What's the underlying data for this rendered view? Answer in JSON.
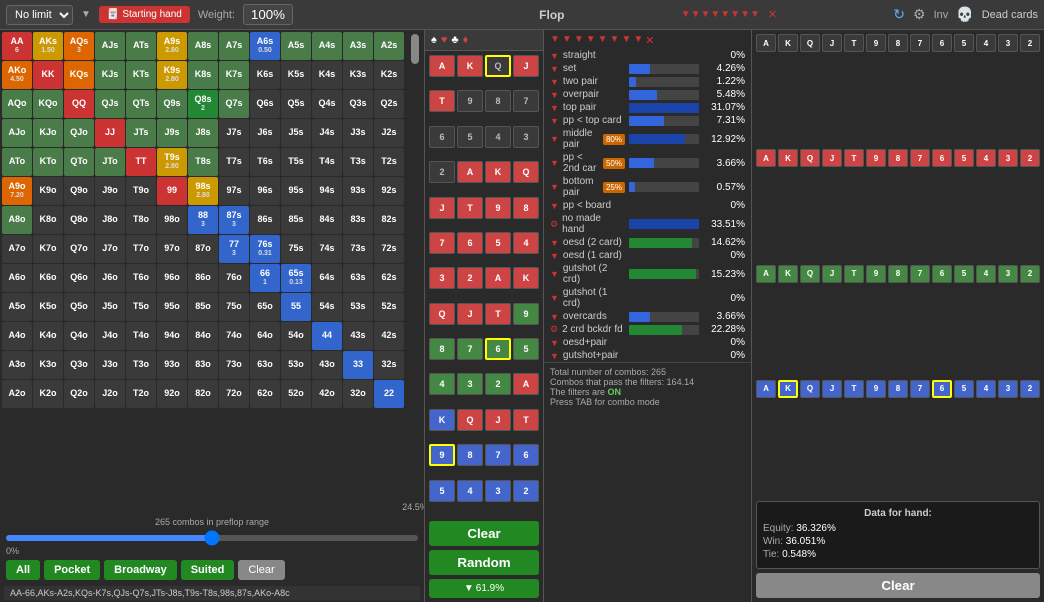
{
  "topbar": {
    "limit_label": "No limit",
    "starting_hand_label": "Starting hand",
    "weight_label": "Weight:",
    "weight_value": "100%",
    "flop_label": "Flop",
    "inv_label": "Inv",
    "dead_cards_label": "Dead cards"
  },
  "range_grid": {
    "combos_info": "265 combos in preflop range",
    "pct_label": "24.5%",
    "pct_zero": "0%",
    "range_text": "AA-66,AKs-A2s,KQs-K7s,QJs-Q7s,JTs-J8s,T9s-T8s,98s,87s,AKo-A8c"
  },
  "bottom_buttons": {
    "all": "All",
    "pocket": "Pocket",
    "broadway": "Broadway",
    "suited": "Suited",
    "clear": "Clear"
  },
  "flop": {
    "clear_label": "Clear",
    "random_label": "Random",
    "filter_pct": "61.9%"
  },
  "stats": {
    "rows": [
      {
        "label": "straight",
        "pct": "0%",
        "bar": 0,
        "badge": ""
      },
      {
        "label": "set",
        "pct": "4.26%",
        "bar": 30,
        "badge": ""
      },
      {
        "label": "two pair",
        "pct": "1.22%",
        "bar": 10,
        "badge": ""
      },
      {
        "label": "overpair",
        "pct": "5.48%",
        "bar": 40,
        "badge": ""
      },
      {
        "label": "top pair",
        "pct": "31.07%",
        "bar": 100,
        "badge": ""
      },
      {
        "label": "pp < top card",
        "pct": "7.31%",
        "bar": 50,
        "badge": ""
      },
      {
        "label": "middle pair",
        "pct": "12.92%",
        "bar": 80,
        "badge": "80%"
      },
      {
        "label": "pp < 2nd car",
        "pct": "3.66%",
        "bar": 35,
        "badge": "50%"
      },
      {
        "label": "bottom pair",
        "pct": "0.57%",
        "bar": 8,
        "badge": "25%"
      },
      {
        "label": "pp < board",
        "pct": "0%",
        "bar": 0,
        "badge": ""
      },
      {
        "label": "no made hand",
        "pct": "33.51%",
        "bar": 100,
        "badge": ""
      },
      {
        "label": "oesd (2 card)",
        "pct": "14.62%",
        "bar": 90,
        "badge": ""
      },
      {
        "label": "oesd (1 card)",
        "pct": "0%",
        "bar": 0,
        "badge": ""
      },
      {
        "label": "gutshot (2 crd)",
        "pct": "15.23%",
        "bar": 95,
        "badge": ""
      },
      {
        "label": "gutshot (1 crd)",
        "pct": "0%",
        "bar": 0,
        "badge": ""
      },
      {
        "label": "overcards",
        "pct": "3.66%",
        "bar": 30,
        "badge": ""
      },
      {
        "label": "2 crd bckdr fd",
        "pct": "22.28%",
        "bar": 75,
        "badge": ""
      },
      {
        "label": "oesd+pair",
        "pct": "0%",
        "bar": 0,
        "badge": ""
      },
      {
        "label": "gutshot+pair",
        "pct": "0%",
        "bar": 0,
        "badge": ""
      }
    ],
    "total_combos": "Total number of combos: 265",
    "combos_pass": "Combos that pass the filters: 164.14",
    "filters_on": "The filters are ON",
    "tab_hint": "Press TAB for combo mode"
  },
  "hand_data": {
    "title": "Data for hand:",
    "equity_label": "Equity:",
    "equity_val": "36.326%",
    "win_label": "Win:",
    "win_val": "36.051%",
    "tie_label": "Tie:",
    "tie_val": "0.548%"
  },
  "dead_cards": {
    "clear_label": "Clear"
  },
  "cells": [
    {
      "id": "AA",
      "label": "AA",
      "sub": "6",
      "class": "selected-red"
    },
    {
      "id": "AKs",
      "label": "AKs",
      "sub": "1.50",
      "class": "selected-yellow"
    },
    {
      "id": "AQs",
      "label": "AQs",
      "sub": "3",
      "class": "selected-orange"
    },
    {
      "id": "AJs",
      "label": "AJs",
      "sub": "",
      "class": "pocket"
    },
    {
      "id": "ATs",
      "label": "ATs",
      "sub": "",
      "class": "pocket"
    },
    {
      "id": "A9s",
      "label": "A9s",
      "sub": "2.80",
      "class": "selected-yellow"
    },
    {
      "id": "A8s",
      "label": "A8s",
      "sub": "",
      "class": "pocket"
    },
    {
      "id": "A7s",
      "label": "A7s",
      "sub": "",
      "class": "pocket"
    },
    {
      "id": "A6s",
      "label": "A6s",
      "sub": "0.50",
      "class": "selected-blue"
    },
    {
      "id": "A5s",
      "label": "A5s",
      "sub": "",
      "class": "pocket"
    },
    {
      "id": "A4s",
      "label": "A4s",
      "sub": "",
      "class": "pocket"
    },
    {
      "id": "A3s",
      "label": "A3s",
      "sub": "",
      "class": "pocket"
    },
    {
      "id": "A2s",
      "label": "A2s",
      "sub": "",
      "class": "pocket"
    },
    {
      "id": "AKo",
      "label": "AKo",
      "sub": "4.50",
      "class": "selected-orange"
    },
    {
      "id": "KK",
      "label": "KK",
      "sub": "",
      "class": "selected-red"
    },
    {
      "id": "KQs",
      "label": "KQs",
      "sub": "",
      "class": "selected-orange"
    },
    {
      "id": "KJs",
      "label": "KJs",
      "sub": "",
      "class": "pocket"
    },
    {
      "id": "KTs",
      "label": "KTs",
      "sub": "",
      "class": "pocket"
    },
    {
      "id": "K9s",
      "label": "K9s",
      "sub": "2.80",
      "class": "selected-yellow"
    },
    {
      "id": "K8s",
      "label": "K8s",
      "sub": "",
      "class": "pocket"
    },
    {
      "id": "K7s",
      "label": "K7s",
      "sub": "",
      "class": "pocket"
    },
    {
      "id": "K6s",
      "label": "K6s",
      "sub": "",
      "class": "empty"
    },
    {
      "id": "K5s",
      "label": "K5s",
      "sub": "",
      "class": "empty"
    },
    {
      "id": "K4s",
      "label": "K4s",
      "sub": "",
      "class": "empty"
    },
    {
      "id": "K3s",
      "label": "K3s",
      "sub": "",
      "class": "empty"
    },
    {
      "id": "K2s",
      "label": "K2s",
      "sub": "",
      "class": "empty"
    },
    {
      "id": "AQo",
      "label": "AQo",
      "sub": "",
      "class": "pocket"
    },
    {
      "id": "KQo",
      "label": "KQo",
      "sub": "",
      "class": "pocket"
    },
    {
      "id": "QQ",
      "label": "QQ",
      "sub": "",
      "class": "selected-red"
    },
    {
      "id": "QJs",
      "label": "QJs",
      "sub": "",
      "class": "pocket"
    },
    {
      "id": "QTs",
      "label": "QTs",
      "sub": "",
      "class": "pocket"
    },
    {
      "id": "Q9s",
      "label": "Q9s",
      "sub": "",
      "class": "pocket"
    },
    {
      "id": "Q8s",
      "label": "Q8s",
      "sub": "2",
      "class": "selected-green"
    },
    {
      "id": "Q7s",
      "label": "Q7s",
      "sub": "",
      "class": "pocket"
    },
    {
      "id": "Q6s",
      "label": "Q6s",
      "sub": "",
      "class": "empty"
    },
    {
      "id": "Q5s",
      "label": "Q5s",
      "sub": "",
      "class": "empty"
    },
    {
      "id": "Q4s",
      "label": "Q4s",
      "sub": "",
      "class": "empty"
    },
    {
      "id": "Q3s",
      "label": "Q3s",
      "sub": "",
      "class": "empty"
    },
    {
      "id": "Q2s",
      "label": "Q2s",
      "sub": "",
      "class": "empty"
    },
    {
      "id": "AJo",
      "label": "AJo",
      "sub": "",
      "class": "pocket"
    },
    {
      "id": "KJo",
      "label": "KJo",
      "sub": "",
      "class": "pocket"
    },
    {
      "id": "QJo",
      "label": "QJo",
      "sub": "",
      "class": "pocket"
    },
    {
      "id": "JJ",
      "label": "JJ",
      "sub": "",
      "class": "selected-red"
    },
    {
      "id": "JTs",
      "label": "JTs",
      "sub": "",
      "class": "pocket"
    },
    {
      "id": "J9s",
      "label": "J9s",
      "sub": "",
      "class": "pocket"
    },
    {
      "id": "J8s",
      "label": "J8s",
      "sub": "",
      "class": "pocket"
    },
    {
      "id": "J7s",
      "label": "J7s",
      "sub": "",
      "class": "empty"
    },
    {
      "id": "J6s",
      "label": "J6s",
      "sub": "",
      "class": "empty"
    },
    {
      "id": "J5s",
      "label": "J5s",
      "sub": "",
      "class": "empty"
    },
    {
      "id": "J4s",
      "label": "J4s",
      "sub": "",
      "class": "empty"
    },
    {
      "id": "J3s",
      "label": "J3s",
      "sub": "",
      "class": "empty"
    },
    {
      "id": "J2s",
      "label": "J2s",
      "sub": "",
      "class": "empty"
    },
    {
      "id": "ATo",
      "label": "ATo",
      "sub": "",
      "class": "pocket"
    },
    {
      "id": "KTo",
      "label": "KTo",
      "sub": "",
      "class": "pocket"
    },
    {
      "id": "QTo",
      "label": "QTo",
      "sub": "",
      "class": "pocket"
    },
    {
      "id": "JTo",
      "label": "JTo",
      "sub": "",
      "class": "pocket"
    },
    {
      "id": "TT",
      "label": "TT",
      "sub": "",
      "class": "selected-red"
    },
    {
      "id": "T9s",
      "label": "T9s",
      "sub": "2.80",
      "class": "selected-yellow"
    },
    {
      "id": "T8s",
      "label": "T8s",
      "sub": "",
      "class": "pocket"
    },
    {
      "id": "T7s",
      "label": "T7s",
      "sub": "",
      "class": "empty"
    },
    {
      "id": "T6s",
      "label": "T6s",
      "sub": "",
      "class": "empty"
    },
    {
      "id": "T5s",
      "label": "T5s",
      "sub": "",
      "class": "empty"
    },
    {
      "id": "T4s",
      "label": "T4s",
      "sub": "",
      "class": "empty"
    },
    {
      "id": "T3s",
      "label": "T3s",
      "sub": "",
      "class": "empty"
    },
    {
      "id": "T2s",
      "label": "T2s",
      "sub": "",
      "class": "empty"
    },
    {
      "id": "A9o",
      "label": "A9o",
      "sub": "7.20",
      "class": "selected-orange"
    },
    {
      "id": "K9o",
      "label": "K9o",
      "sub": "",
      "class": "empty"
    },
    {
      "id": "Q9o",
      "label": "Q9o",
      "sub": "",
      "class": "empty"
    },
    {
      "id": "J9o",
      "label": "J9o",
      "sub": "",
      "class": "empty"
    },
    {
      "id": "T9o",
      "label": "T9o",
      "sub": "",
      "class": "empty"
    },
    {
      "id": "99",
      "label": "99",
      "sub": "",
      "class": "selected-red"
    },
    {
      "id": "98s",
      "label": "98s",
      "sub": "2.80",
      "class": "selected-yellow"
    },
    {
      "id": "97s",
      "label": "97s",
      "sub": "",
      "class": "empty"
    },
    {
      "id": "96s",
      "label": "96s",
      "sub": "",
      "class": "empty"
    },
    {
      "id": "95s",
      "label": "95s",
      "sub": "",
      "class": "empty"
    },
    {
      "id": "94s",
      "label": "94s",
      "sub": "",
      "class": "empty"
    },
    {
      "id": "93s",
      "label": "93s",
      "sub": "",
      "class": "empty"
    },
    {
      "id": "92s",
      "label": "92s",
      "sub": "",
      "class": "empty"
    },
    {
      "id": "A8o",
      "label": "A8o",
      "sub": "",
      "class": "pocket"
    },
    {
      "id": "K8o",
      "label": "K8o",
      "sub": "",
      "class": "empty"
    },
    {
      "id": "Q8o",
      "label": "Q8o",
      "sub": "",
      "class": "empty"
    },
    {
      "id": "J8o",
      "label": "J8o",
      "sub": "",
      "class": "empty"
    },
    {
      "id": "T8o",
      "label": "T8o",
      "sub": "",
      "class": "empty"
    },
    {
      "id": "98o",
      "label": "98o",
      "sub": "",
      "class": "empty"
    },
    {
      "id": "88",
      "label": "88",
      "sub": "3",
      "class": "selected-blue"
    },
    {
      "id": "87s",
      "label": "87s",
      "sub": "3",
      "class": "selected-blue"
    },
    {
      "id": "86s",
      "label": "86s",
      "sub": "",
      "class": "empty"
    },
    {
      "id": "85s",
      "label": "85s",
      "sub": "",
      "class": "empty"
    },
    {
      "id": "84s",
      "label": "84s",
      "sub": "",
      "class": "empty"
    },
    {
      "id": "83s",
      "label": "83s",
      "sub": "",
      "class": "empty"
    },
    {
      "id": "82s",
      "label": "82s",
      "sub": "",
      "class": "empty"
    },
    {
      "id": "A7o",
      "label": "A7o",
      "sub": "",
      "class": "empty"
    },
    {
      "id": "K7o",
      "label": "K7o",
      "sub": "",
      "class": "empty"
    },
    {
      "id": "Q7o",
      "label": "Q7o",
      "sub": "",
      "class": "empty"
    },
    {
      "id": "J7o",
      "label": "J7o",
      "sub": "",
      "class": "empty"
    },
    {
      "id": "T7o",
      "label": "T7o",
      "sub": "",
      "class": "empty"
    },
    {
      "id": "97o",
      "label": "97o",
      "sub": "",
      "class": "empty"
    },
    {
      "id": "87o",
      "label": "87o",
      "sub": "",
      "class": "empty"
    },
    {
      "id": "77",
      "label": "77",
      "sub": "3",
      "class": "selected-blue"
    },
    {
      "id": "76s",
      "label": "76s",
      "sub": "0.31",
      "class": "selected-blue"
    },
    {
      "id": "75s",
      "label": "75s",
      "sub": "",
      "class": "empty"
    },
    {
      "id": "74s",
      "label": "74s",
      "sub": "",
      "class": "empty"
    },
    {
      "id": "73s",
      "label": "73s",
      "sub": "",
      "class": "empty"
    },
    {
      "id": "72s",
      "label": "72s",
      "sub": "",
      "class": "empty"
    },
    {
      "id": "A6o",
      "label": "A6o",
      "sub": "",
      "class": "empty"
    },
    {
      "id": "K6o",
      "label": "K6o",
      "sub": "",
      "class": "empty"
    },
    {
      "id": "Q6o",
      "label": "Q6o",
      "sub": "",
      "class": "empty"
    },
    {
      "id": "J6o",
      "label": "J6o",
      "sub": "",
      "class": "empty"
    },
    {
      "id": "T6o",
      "label": "T6o",
      "sub": "",
      "class": "empty"
    },
    {
      "id": "96o",
      "label": "96o",
      "sub": "",
      "class": "empty"
    },
    {
      "id": "86o",
      "label": "86o",
      "sub": "",
      "class": "empty"
    },
    {
      "id": "76o",
      "label": "76o",
      "sub": "",
      "class": "empty"
    },
    {
      "id": "66",
      "label": "66",
      "sub": "1",
      "class": "selected-blue"
    },
    {
      "id": "65s",
      "label": "65s",
      "sub": "0.13",
      "class": "selected-blue"
    },
    {
      "id": "64s",
      "label": "64s",
      "sub": "",
      "class": "empty"
    },
    {
      "id": "63s",
      "label": "63s",
      "sub": "",
      "class": "empty"
    },
    {
      "id": "62s",
      "label": "62s",
      "sub": "",
      "class": "empty"
    },
    {
      "id": "A5o",
      "label": "A5o",
      "sub": "",
      "class": "empty"
    },
    {
      "id": "K5o",
      "label": "K5o",
      "sub": "",
      "class": "empty"
    },
    {
      "id": "Q5o",
      "label": "Q5o",
      "sub": "",
      "class": "empty"
    },
    {
      "id": "J5o",
      "label": "J5o",
      "sub": "",
      "class": "empty"
    },
    {
      "id": "T5o",
      "label": "T5o",
      "sub": "",
      "class": "empty"
    },
    {
      "id": "95o",
      "label": "95o",
      "sub": "",
      "class": "empty"
    },
    {
      "id": "85o",
      "label": "85o",
      "sub": "",
      "class": "empty"
    },
    {
      "id": "75o",
      "label": "75o",
      "sub": "",
      "class": "empty"
    },
    {
      "id": "65o",
      "label": "65o",
      "sub": "",
      "class": "empty"
    },
    {
      "id": "55",
      "label": "55",
      "sub": "",
      "class": "selected-blue"
    },
    {
      "id": "54s",
      "label": "54s",
      "sub": "",
      "class": "empty"
    },
    {
      "id": "53s",
      "label": "53s",
      "sub": "",
      "class": "empty"
    },
    {
      "id": "52s",
      "label": "52s",
      "sub": "",
      "class": "empty"
    },
    {
      "id": "A4o",
      "label": "A4o",
      "sub": "",
      "class": "empty"
    },
    {
      "id": "K4o",
      "label": "K4o",
      "sub": "",
      "class": "empty"
    },
    {
      "id": "Q4o",
      "label": "Q4o",
      "sub": "",
      "class": "empty"
    },
    {
      "id": "J4o",
      "label": "J4o",
      "sub": "",
      "class": "empty"
    },
    {
      "id": "T4o",
      "label": "T4o",
      "sub": "",
      "class": "empty"
    },
    {
      "id": "94o",
      "label": "94o",
      "sub": "",
      "class": "empty"
    },
    {
      "id": "84o",
      "label": "84o",
      "sub": "",
      "class": "empty"
    },
    {
      "id": "74o",
      "label": "74o",
      "sub": "",
      "class": "empty"
    },
    {
      "id": "64o",
      "label": "64o",
      "sub": "",
      "class": "empty"
    },
    {
      "id": "54o",
      "label": "54o",
      "sub": "",
      "class": "empty"
    },
    {
      "id": "44",
      "label": "44",
      "sub": "",
      "class": "selected-blue"
    },
    {
      "id": "43s",
      "label": "43s",
      "sub": "",
      "class": "empty"
    },
    {
      "id": "42s",
      "label": "42s",
      "sub": "",
      "class": "empty"
    },
    {
      "id": "A3o",
      "label": "A3o",
      "sub": "",
      "class": "empty"
    },
    {
      "id": "K3o",
      "label": "K3o",
      "sub": "",
      "class": "empty"
    },
    {
      "id": "Q3o",
      "label": "Q3o",
      "sub": "",
      "class": "empty"
    },
    {
      "id": "J3o",
      "label": "J3o",
      "sub": "",
      "class": "empty"
    },
    {
      "id": "T3o",
      "label": "T3o",
      "sub": "",
      "class": "empty"
    },
    {
      "id": "93o",
      "label": "93o",
      "sub": "",
      "class": "empty"
    },
    {
      "id": "83o",
      "label": "83o",
      "sub": "",
      "class": "empty"
    },
    {
      "id": "73o",
      "label": "73o",
      "sub": "",
      "class": "empty"
    },
    {
      "id": "63o",
      "label": "63o",
      "sub": "",
      "class": "empty"
    },
    {
      "id": "53o",
      "label": "53o",
      "sub": "",
      "class": "empty"
    },
    {
      "id": "43o",
      "label": "43o",
      "sub": "",
      "class": "empty"
    },
    {
      "id": "33",
      "label": "33",
      "sub": "",
      "class": "selected-blue"
    },
    {
      "id": "32s",
      "label": "32s",
      "sub": "",
      "class": "empty"
    },
    {
      "id": "A2o",
      "label": "A2o",
      "sub": "",
      "class": "empty"
    },
    {
      "id": "K2o",
      "label": "K2o",
      "sub": "",
      "class": "empty"
    },
    {
      "id": "Q2o",
      "label": "Q2o",
      "sub": "",
      "class": "empty"
    },
    {
      "id": "J2o",
      "label": "J2o",
      "sub": "",
      "class": "empty"
    },
    {
      "id": "T2o",
      "label": "T2o",
      "sub": "",
      "class": "empty"
    },
    {
      "id": "92o",
      "label": "92o",
      "sub": "",
      "class": "empty"
    },
    {
      "id": "82o",
      "label": "82o",
      "sub": "",
      "class": "empty"
    },
    {
      "id": "72o",
      "label": "72o",
      "sub": "",
      "class": "empty"
    },
    {
      "id": "62o",
      "label": "62o",
      "sub": "",
      "class": "empty"
    },
    {
      "id": "52o",
      "label": "52o",
      "sub": "",
      "class": "empty"
    },
    {
      "id": "42o",
      "label": "42o",
      "sub": "",
      "class": "empty"
    },
    {
      "id": "32o",
      "label": "32o",
      "sub": "",
      "class": "empty"
    },
    {
      "id": "22",
      "label": "22",
      "sub": "",
      "class": "selected-blue"
    }
  ]
}
